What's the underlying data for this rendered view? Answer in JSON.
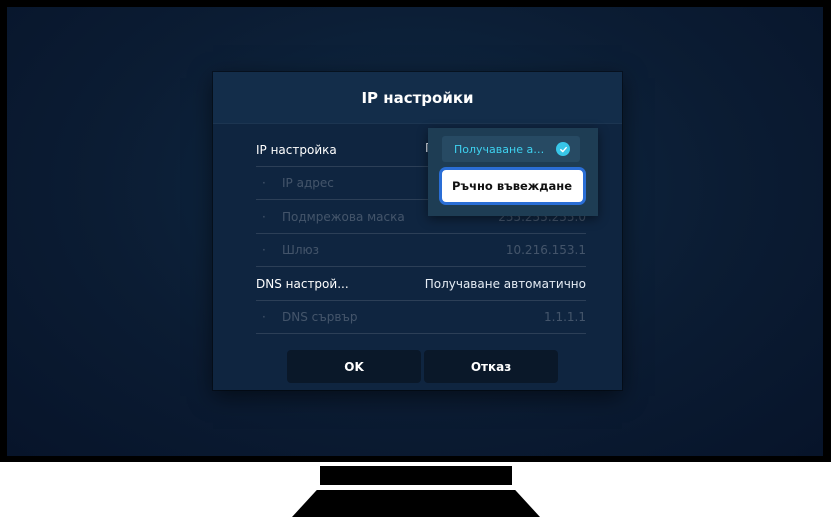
{
  "dialog": {
    "title": "IP настройки",
    "rows": [
      {
        "label": "IP настройка",
        "value": "Получаване автоматично"
      },
      {
        "label": "IP адрес",
        "value": ""
      },
      {
        "label": "Подмрежова маска",
        "value": "255.255.255.0"
      },
      {
        "label": "Шлюз",
        "value": "10.216.153.1"
      },
      {
        "label": "DNS настрой...",
        "value": "Получаване автоматично"
      },
      {
        "label": "DNS сървър",
        "value": "1.1.1.1"
      }
    ],
    "buttons": {
      "ok": "OK",
      "cancel": "Отказ"
    }
  },
  "dropdown": {
    "selected": "Получаване ав...",
    "focused": "Ръчно въвеждане",
    "colors": {
      "accent": "#3ed2f0",
      "focus_border": "#2a6ed6"
    }
  },
  "icons": {
    "check": "check-circle-icon"
  }
}
